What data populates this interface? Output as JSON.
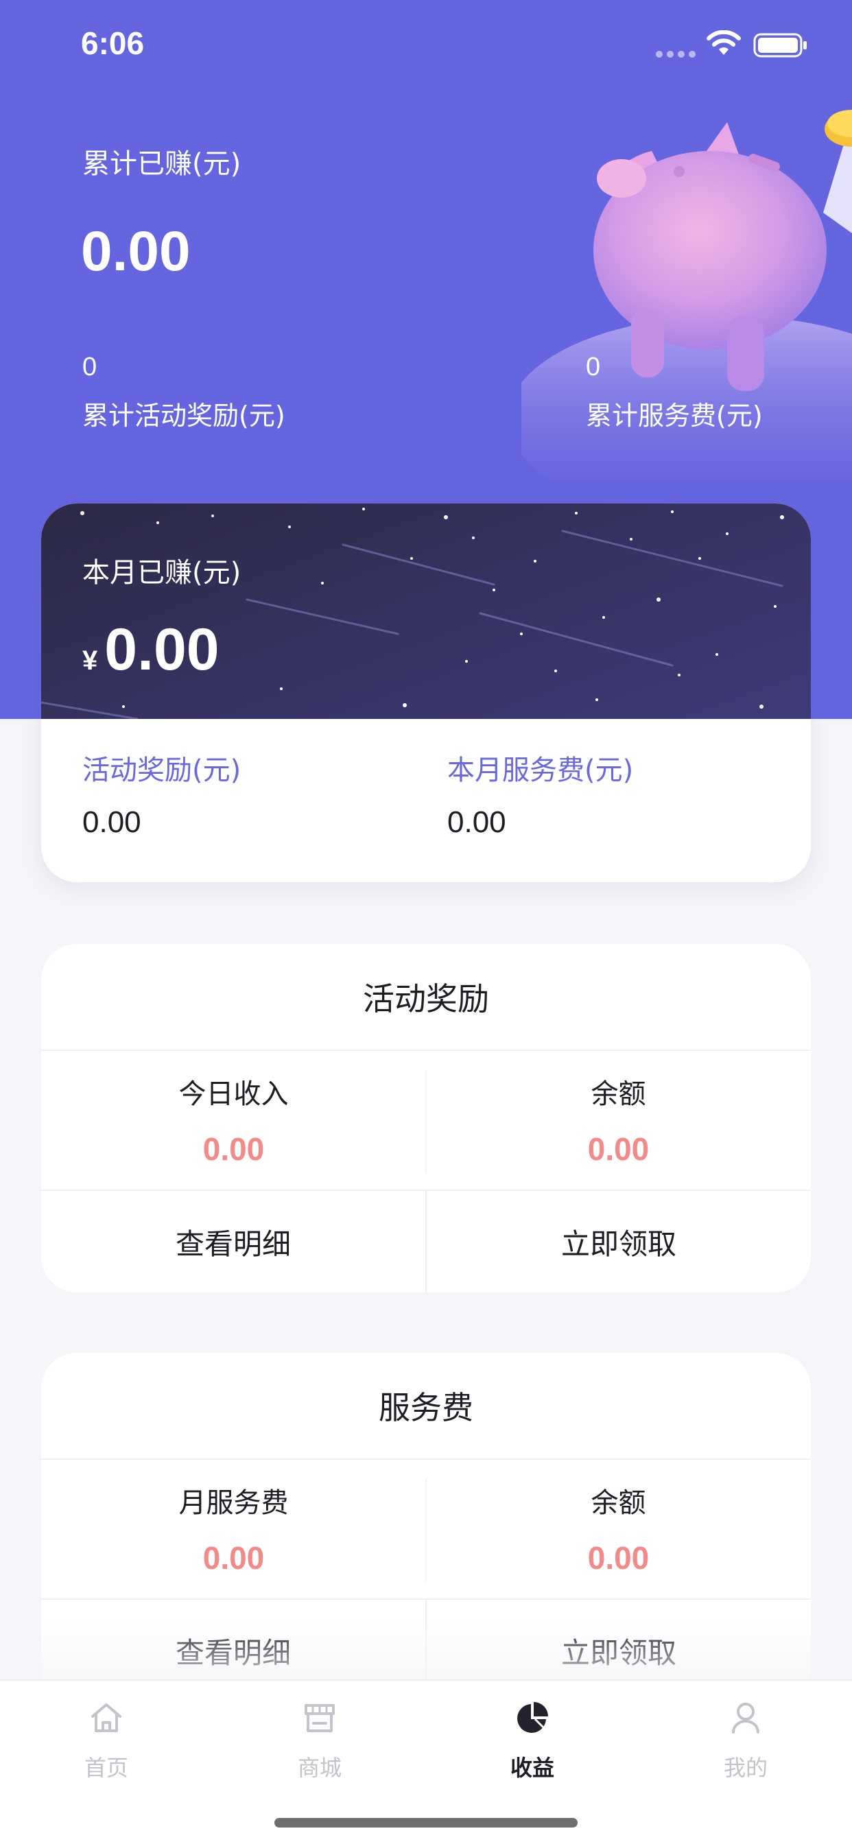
{
  "status_bar": {
    "time": "6:06"
  },
  "header": {
    "total_label": "累计已赚(元)",
    "total_value": "0.00",
    "activity_reward_total": {
      "value": "0",
      "label": "累计活动奖励(元)"
    },
    "service_fee_total": {
      "value": "0",
      "label": "累计服务费(元)"
    }
  },
  "month_card": {
    "label": "本月已赚(元)",
    "currency": "¥",
    "value": "0.00",
    "activity_reward": {
      "label": "活动奖励(元)",
      "value": "0.00"
    },
    "service_fee": {
      "label": "本月服务费(元)",
      "value": "0.00"
    }
  },
  "activity_card": {
    "title": "活动奖励",
    "today_income": {
      "label": "今日收入",
      "value": "0.00"
    },
    "balance": {
      "label": "余额",
      "value": "0.00"
    },
    "details_button": "查看明细",
    "claim_button": "立即领取"
  },
  "service_card": {
    "title": "服务费",
    "monthly_fee": {
      "label": "月服务费",
      "value": "0.00"
    },
    "balance": {
      "label": "余额",
      "value": "0.00"
    },
    "details_button": "查看明细",
    "claim_button": "立即领取"
  },
  "tab_bar": {
    "items": [
      {
        "label": "首页",
        "icon": "home-icon",
        "active": false
      },
      {
        "label": "商城",
        "icon": "store-icon",
        "active": false
      },
      {
        "label": "收益",
        "icon": "pie-chart-icon",
        "active": true
      },
      {
        "label": "我的",
        "icon": "profile-icon",
        "active": false
      }
    ]
  },
  "colors": {
    "header_bg": "#6565e0",
    "accent_purple": "#6b67dc",
    "value_red": "#f28a8a",
    "card_dark": "#2b2945",
    "page_bg": "#f4f5f9"
  }
}
